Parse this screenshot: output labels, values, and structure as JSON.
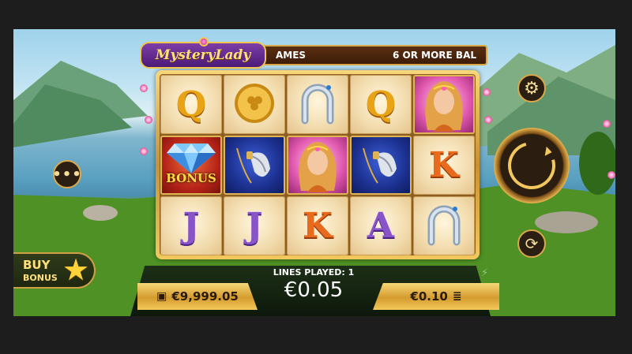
{
  "game": {
    "logo_text": "MysteryLady",
    "ticker_left": "AMES",
    "ticker_right": "6 OR MORE BAL"
  },
  "reels": {
    "columns": [
      [
        {
          "symbol": "Q",
          "style": "gold"
        },
        {
          "symbol": "bonus-diamond",
          "label": "BONUS",
          "style": "red"
        },
        {
          "symbol": "J",
          "style": "purple"
        }
      ],
      [
        {
          "symbol": "gold-coin",
          "style": "plain"
        },
        {
          "symbol": "feather-pendant",
          "style": "blue"
        },
        {
          "symbol": "J",
          "style": "purple"
        }
      ],
      [
        {
          "symbol": "horseshoe",
          "style": "plain"
        },
        {
          "symbol": "mystery-lady",
          "style": "pink"
        },
        {
          "symbol": "K",
          "style": "orange"
        }
      ],
      [
        {
          "symbol": "Q",
          "style": "gold"
        },
        {
          "symbol": "feather-pendant",
          "style": "blue"
        },
        {
          "symbol": "A",
          "style": "purple"
        }
      ],
      [
        {
          "symbol": "mystery-lady",
          "style": "pink"
        },
        {
          "symbol": "K",
          "style": "orange"
        },
        {
          "symbol": "horseshoe",
          "style": "plain"
        }
      ]
    ]
  },
  "controls": {
    "settings_icon": "gear-icon",
    "spin_icon": "spin-arrow-icon",
    "autoplay_icon": "autoplay-icon",
    "menu_icon": "more-icon",
    "menu_glyph": "•••",
    "settings_glyph": "⚙",
    "autoplay_glyph": "⟳"
  },
  "buy_bonus": {
    "line1": "BUY",
    "line2": "BONUS",
    "star": "★"
  },
  "bottom": {
    "lines_played": "LINES PLAYED: 1",
    "bet_amount": "€0.05",
    "balance": "€9,999.05",
    "stake": "€0.10",
    "bolt_glyph": "⚡",
    "wallet_glyph": "👜",
    "coins_glyph": "🪙"
  },
  "colors": {
    "gold": "#e9a317",
    "purple": "#8a54c9",
    "orange": "#e86a1d",
    "frame_gold": "#d7a944"
  }
}
